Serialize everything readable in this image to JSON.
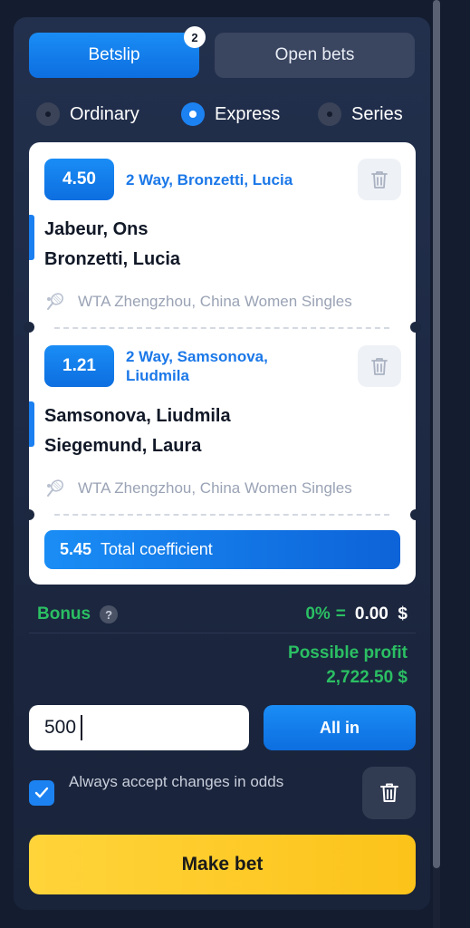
{
  "tabs": {
    "betslip_label": "Betslip",
    "betslip_badge": "2",
    "open_bets_label": "Open bets"
  },
  "bet_types": [
    {
      "label": "Ordinary",
      "selected": false
    },
    {
      "label": "Express",
      "selected": true
    },
    {
      "label": "Series",
      "selected": false
    }
  ],
  "bets": [
    {
      "odds": "4.50",
      "market": "2 Way, Bronzetti, Lucia",
      "team1": "Jabeur, Ons",
      "team2": "Bronzetti, Lucia",
      "league": "WTA Zhengzhou, China Women Singles",
      "sport_icon": "tennis-icon"
    },
    {
      "odds": "1.21",
      "market_line1": "2 Way, Samsonova,",
      "market_line2": "Liudmila",
      "team1": "Samsonova, Liudmila",
      "team2": "Siegemund, Laura",
      "league": "WTA Zhengzhou, China Women Singles",
      "sport_icon": "tennis-icon"
    }
  ],
  "total": {
    "value": "5.45",
    "label": "Total coefficient"
  },
  "bonus": {
    "label": "Bonus",
    "help": "?",
    "percent": "0%",
    "equals": "=",
    "amount": "0.00  $"
  },
  "profit": {
    "label": "Possible profit",
    "value": "2,722.50 $"
  },
  "stake": {
    "value": "500"
  },
  "all_in_label": "All in",
  "accept_changes": {
    "label": "Always accept changes in odds",
    "checked": true
  },
  "make_bet_label": "Make bet",
  "colors": {
    "accent_blue": "#1a7ff0",
    "profit_green": "#2bbf63",
    "make_bet_yellow": "#fcc31a",
    "panel_bg": "#1c2740"
  }
}
